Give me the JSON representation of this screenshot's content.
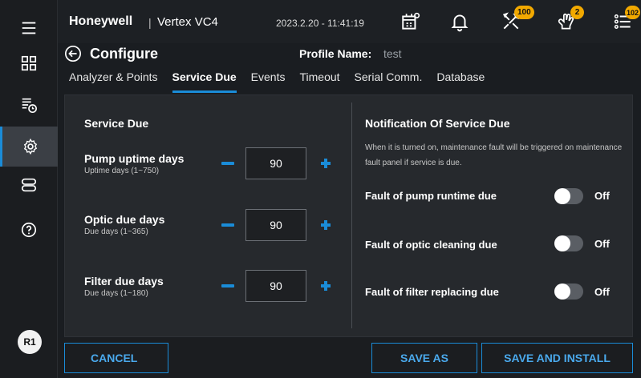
{
  "topbar": {
    "brand": "Honeywell",
    "separator": "|",
    "model": "Vertex VC4",
    "datetime": "2023.2.20 - 11:41:19",
    "badges": {
      "maintenance": "100",
      "alarms": "2",
      "list": "102"
    }
  },
  "sidebar": {
    "user_initials": "R1"
  },
  "header": {
    "title": "Configure",
    "profile_label": "Profile Name:",
    "profile_value": "test"
  },
  "tabs": [
    {
      "label": "Analyzer & Points"
    },
    {
      "label": "Service Due"
    },
    {
      "label": "Events"
    },
    {
      "label": "Timeout"
    },
    {
      "label": "Serial Comm."
    },
    {
      "label": "Database"
    }
  ],
  "service_due": {
    "title": "Service Due",
    "fields": [
      {
        "label": "Pump uptime days",
        "hint": "Uptime days (1~750)",
        "value": "90"
      },
      {
        "label": "Optic due days",
        "hint": "Due days (1~365)",
        "value": "90"
      },
      {
        "label": "Filter due days",
        "hint": "Due days (1~180)",
        "value": "90"
      }
    ]
  },
  "notification": {
    "title": "Notification Of Service Due",
    "description": "When it is turned on, maintenance fault will be triggered on maintenance fault panel if service is due.",
    "toggles": [
      {
        "label": "Fault of pump runtime due",
        "state": "Off"
      },
      {
        "label": "Fault of optic cleaning due",
        "state": "Off"
      },
      {
        "label": "Fault of filter replacing due",
        "state": "Off"
      }
    ]
  },
  "buttons": {
    "cancel": "CANCEL",
    "save_as": "SAVE AS",
    "save_install": "SAVE AND INSTALL"
  },
  "colors": {
    "accent": "#1a8cd8",
    "badge": "#f2a900",
    "background": "#1a1d21",
    "panel": "#26292d"
  }
}
